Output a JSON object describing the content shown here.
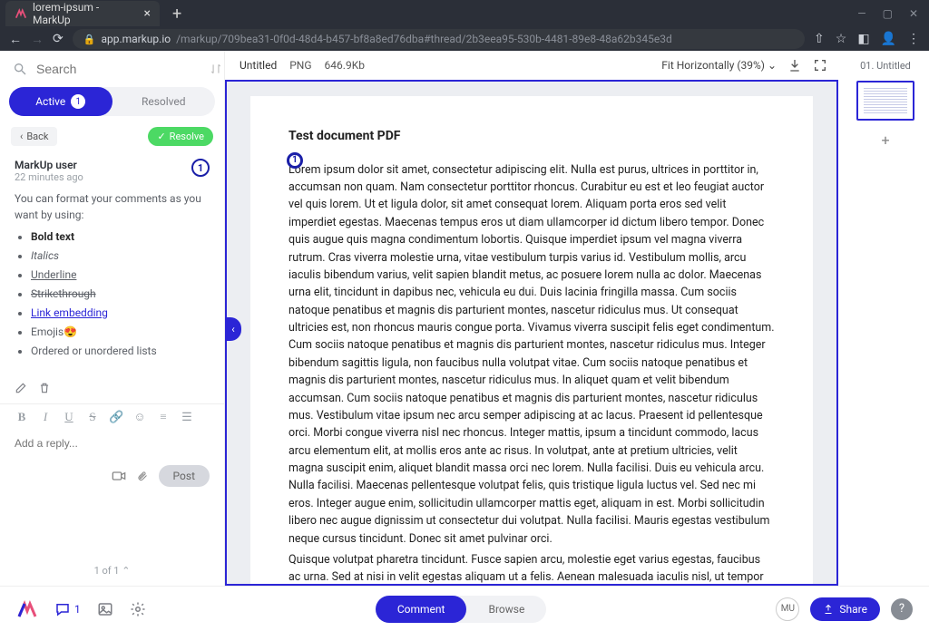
{
  "browser": {
    "tab_title": "lorem-ipsum - MarkUp",
    "url_host": "app.markup.io",
    "url_path": "/markup/709bea31-0f0d-48d4-b457-bf8a8ed76dba#thread/2b3eea95-530b-4481-89e8-48a62b345e3d"
  },
  "sidebar": {
    "search_placeholder": "Search",
    "tabs": {
      "active": "Active",
      "active_count": "1",
      "resolved": "Resolved"
    },
    "back_label": "Back",
    "resolve_label": "Resolve",
    "comment": {
      "author": "MarkUp user",
      "time": "22 minutes ago",
      "marker": "1",
      "body_intro": "You can format your comments as you want by using:",
      "bullets": {
        "bold": "Bold text",
        "italic": "Italics",
        "underline": "Underline",
        "strike": "Strikethrough",
        "link": "Link embedding",
        "emoji_label": "Emojis",
        "emoji_glyph": "😍",
        "lists": "Ordered or unordered lists"
      }
    },
    "reply_placeholder": "Add a reply...",
    "post_label": "Post",
    "pager": "1 of 1"
  },
  "canvas": {
    "filename": "Untitled",
    "filetype": "PNG",
    "filesize": "646.9Kb",
    "zoom_label": "Fit Horizontally (39%)",
    "marker": "1"
  },
  "document": {
    "title": "Test document PDF",
    "p1": "Lorem ipsum dolor sit amet, consectetur adipiscing elit. Nulla est purus, ultrices in porttitor in, accumsan non quam. Nam consectetur porttitor rhoncus. Curabitur eu est et leo feugiat auctor vel quis lorem. Ut et ligula dolor, sit amet consequat lorem. Aliquam porta eros sed velit imperdiet egestas. Maecenas tempus eros ut diam ullamcorper id dictum libero tempor. Donec quis augue quis magna condimentum lobortis. Quisque imperdiet ipsum vel magna viverra rutrum. Cras viverra molestie urna, vitae vestibulum turpis varius id. Vestibulum mollis, arcu iaculis bibendum varius, velit sapien blandit metus, ac posuere lorem nulla ac dolor. Maecenas urna elit, tincidunt in dapibus nec, vehicula eu dui. Duis lacinia fringilla massa. Cum sociis natoque penatibus et magnis dis parturient montes, nascetur ridiculus mus. Ut consequat ultricies est, non rhoncus mauris congue porta. Vivamus viverra suscipit felis eget condimentum. Cum sociis natoque penatibus et magnis dis parturient montes, nascetur ridiculus mus. Integer bibendum sagittis ligula, non faucibus nulla volutpat vitae. Cum sociis natoque penatibus et magnis dis parturient montes, nascetur ridiculus mus. In aliquet quam et velit bibendum accumsan. Cum sociis natoque penatibus et magnis dis parturient montes, nascetur ridiculus mus. Vestibulum vitae ipsum nec arcu semper adipiscing at ac lacus. Praesent id pellentesque orci. Morbi congue viverra nisl nec rhoncus. Integer mattis, ipsum a tincidunt commodo, lacus arcu elementum elit, at mollis eros ante ac risus. In volutpat, ante at pretium ultricies, velit magna suscipit enim, aliquet blandit massa orci nec lorem. Nulla facilisi. Duis eu vehicula arcu. Nulla facilisi. Maecenas pellentesque volutpat felis, quis tristique ligula luctus vel. Sed nec mi eros. Integer augue enim, sollicitudin ullamcorper mattis eget, aliquam in est. Morbi sollicitudin libero nec augue dignissim ut consectetur dui volutpat. Nulla facilisi. Mauris egestas vestibulum neque cursus tincidunt. Donec sit amet pulvinar orci.",
    "p2": "Quisque volutpat pharetra tincidunt. Fusce sapien arcu, molestie eget varius egestas, faucibus ac urna. Sed at nisi in velit egestas aliquam ut a felis. Aenean malesuada iaculis nisl, ut tempor lacus egestas consequat. Nam nibh lectus, gravida sed egestas ut, feugiat quis"
  },
  "thumbs": {
    "label": "01. Untitled"
  },
  "bottombar": {
    "comment_count": "1",
    "comment_btn": "Comment",
    "browse_btn": "Browse",
    "avatar_initials": "MU",
    "share_label": "Share"
  }
}
